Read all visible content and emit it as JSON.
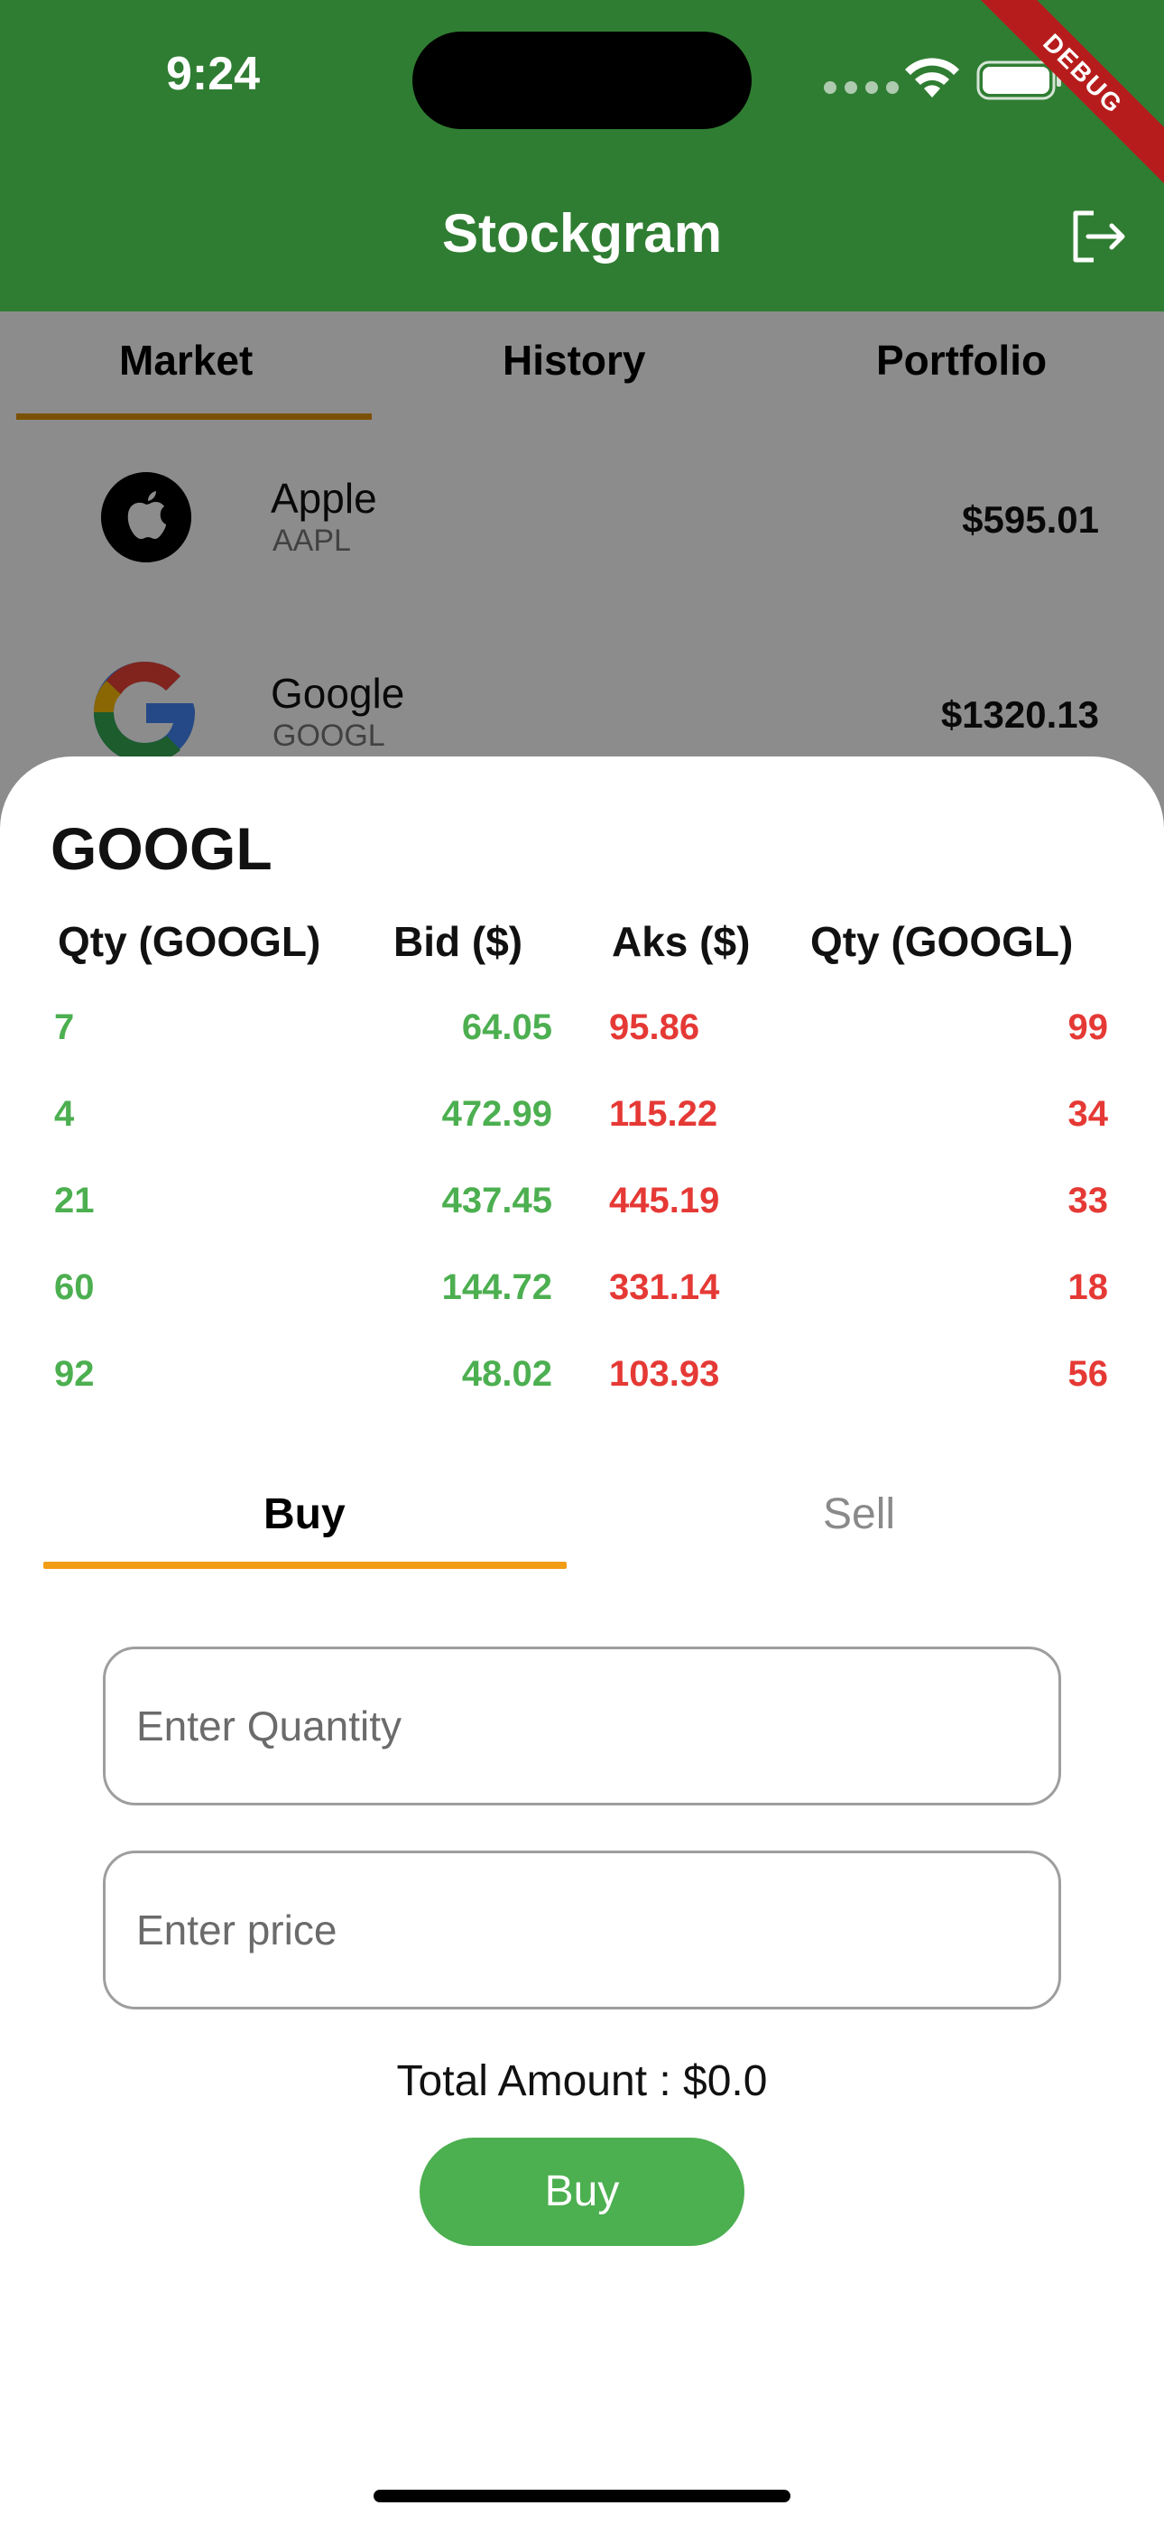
{
  "status_bar": {
    "time": "9:24"
  },
  "debug_banner": "DEBUG",
  "app_bar": {
    "title": "Stockgram",
    "logout_icon": "logout-icon"
  },
  "tabs": [
    {
      "label": "Market",
      "active": true
    },
    {
      "label": "History",
      "active": false
    },
    {
      "label": "Portfolio",
      "active": false
    }
  ],
  "stocks": [
    {
      "name": "Apple",
      "symbol": "AAPL",
      "price": "$595.01",
      "icon": "apple-logo-icon"
    },
    {
      "name": "Google",
      "symbol": "GOOGL",
      "price": "$1320.13",
      "icon": "google-logo-icon"
    }
  ],
  "sheet": {
    "title": "GOOGL",
    "order_book": {
      "headers": [
        "Qty (GOOGL)",
        "Bid ($)",
        "Aks ($)",
        "Qty (GOOGL)"
      ],
      "rows": [
        {
          "bid_qty": "7",
          "bid": "64.05",
          "ask": "95.86",
          "ask_qty": "99"
        },
        {
          "bid_qty": "4",
          "bid": "472.99",
          "ask": "115.22",
          "ask_qty": "34"
        },
        {
          "bid_qty": "21",
          "bid": "437.45",
          "ask": "445.19",
          "ask_qty": "33"
        },
        {
          "bid_qty": "60",
          "bid": "144.72",
          "ask": "331.14",
          "ask_qty": "18"
        },
        {
          "bid_qty": "92",
          "bid": "48.02",
          "ask": "103.93",
          "ask_qty": "56"
        }
      ]
    },
    "trade_tabs": [
      {
        "label": "Buy",
        "active": true
      },
      {
        "label": "Sell",
        "active": false
      }
    ],
    "quantity_placeholder": "Enter Quantity",
    "price_placeholder": "Enter price",
    "total_amount": "Total Amount : $0.0",
    "action_button": "Buy"
  },
  "colors": {
    "app_bar": "#2f7d32",
    "bid": "#4caf50",
    "ask": "#e53935",
    "tab_indicator": "#f29d16",
    "buy_button": "#4caf50"
  }
}
